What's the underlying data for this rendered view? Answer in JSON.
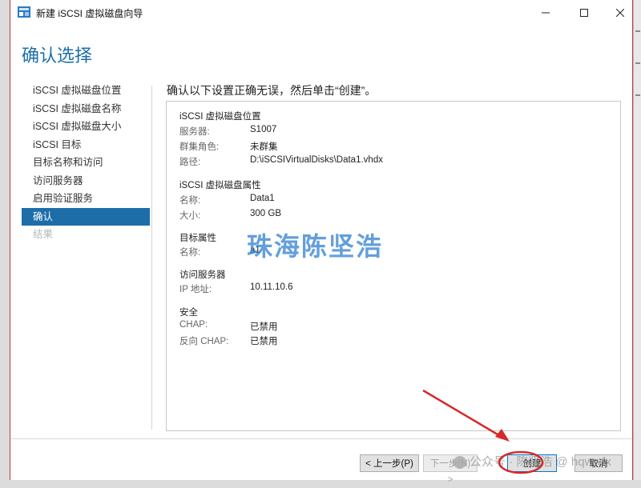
{
  "window": {
    "title": "新建 iSCSI 虚拟磁盘向导",
    "page_title": "确认选择"
  },
  "nav": {
    "items": [
      {
        "label": "iSCSI 虚拟磁盘位置",
        "state": "normal"
      },
      {
        "label": "iSCSI 虚拟磁盘名称",
        "state": "normal"
      },
      {
        "label": "iSCSI 虚拟磁盘大小",
        "state": "normal"
      },
      {
        "label": "iSCSI 目标",
        "state": "normal"
      },
      {
        "label": "目标名称和访问",
        "state": "normal"
      },
      {
        "label": "访问服务器",
        "state": "normal"
      },
      {
        "label": "启用验证服务",
        "state": "normal"
      },
      {
        "label": "确认",
        "state": "active"
      },
      {
        "label": "结果",
        "state": "disabled"
      }
    ]
  },
  "main": {
    "instruction": "确认以下设置正确无误，然后单击“创建”。",
    "sections": {
      "location": {
        "title": "iSCSI 虚拟磁盘位置",
        "server_label": "服务器:",
        "server_value": "S1007",
        "cluster_label": "群集角色:",
        "cluster_value": "未群集",
        "path_label": "路径:",
        "path_value": "D:\\iSCSIVirtualDisks\\Data1.vhdx"
      },
      "properties": {
        "title": "iSCSI 虚拟磁盘属性",
        "name_label": "名称:",
        "name_value": "Data1",
        "size_label": "大小:",
        "size_value": "300 GB"
      },
      "target": {
        "title": "目标属性",
        "name_label": "名称:",
        "name_value": "a1"
      },
      "access": {
        "title": "访问服务器",
        "ip_label": "IP 地址:",
        "ip_value": "10.11.10.6"
      },
      "security": {
        "title": "安全",
        "chap_label": "CHAP:",
        "chap_value": "已禁用",
        "reverse_chap_label": "反向 CHAP:",
        "reverse_chap_value": "已禁用"
      }
    }
  },
  "watermark": "珠海陈坚浩",
  "social_overlay": "公众号 · 陈坚浩",
  "social_handle": "@ hqwwfx",
  "buttons": {
    "prev": "< 上一步(P)",
    "next": "下一步(N) >",
    "create": "创建",
    "cancel": "取消"
  },
  "colors": {
    "accent": "#1d6ea8",
    "title_blue": "#1c6fa8",
    "annotation_red": "#d42a2a"
  }
}
